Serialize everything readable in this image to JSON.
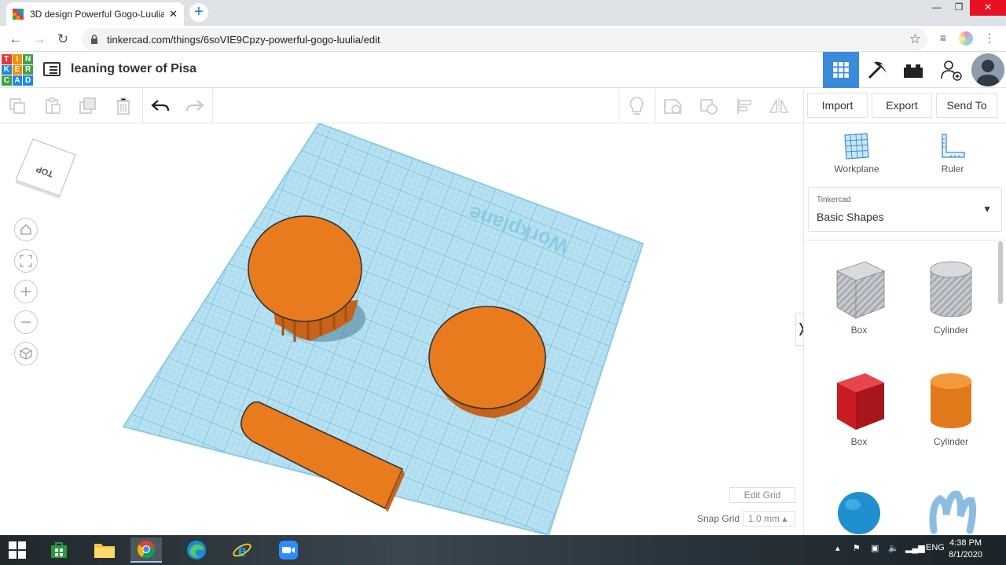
{
  "browser": {
    "tab_title": "3D design Powerful Gogo-Luulia",
    "tab_close": "✕",
    "new_tab": "+",
    "url": "tinkercad.com/things/6soVIE9Cpzy-powerful-gogo-luulia/edit",
    "window_controls": [
      "—",
      "❐",
      "✕"
    ]
  },
  "app": {
    "logo_letters": [
      "T",
      "I",
      "N",
      "K",
      "E",
      "R",
      "C",
      "A",
      "D"
    ],
    "design_title": "leaning tower of Pisa"
  },
  "edit_toolbar": {
    "import_label": "Import",
    "export_label": "Export",
    "send_to_label": "Send To"
  },
  "viewport": {
    "viewcube_label": "TOP",
    "workplane_label": "Workplane",
    "edit_grid_label": "Edit Grid",
    "snap_grid_label": "Snap Grid",
    "snap_grid_value": "1.0 mm ▴",
    "collapse_glyph": "❭"
  },
  "panel": {
    "workplane_label": "Workplane",
    "ruler_label": "Ruler",
    "library_source": "Tinkercad",
    "library_name": "Basic Shapes",
    "shapes": [
      {
        "label": "Box",
        "icon": "box-hole-icon"
      },
      {
        "label": "Cylinder",
        "icon": "cylinder-hole-icon"
      },
      {
        "label": "Box",
        "icon": "box-solid-icon"
      },
      {
        "label": "Cylinder",
        "icon": "cylinder-solid-icon"
      },
      {
        "label": "",
        "icon": "sphere-icon"
      },
      {
        "label": "",
        "icon": "scribble-icon"
      }
    ]
  },
  "taskbar": {
    "language": "ENG",
    "time": "4:38 PM",
    "date": "8/1/2020"
  },
  "colors": {
    "accent": "#3a8bd9",
    "shape_orange": "#e87b1e",
    "workplane_blue": "#a8d8ea"
  }
}
